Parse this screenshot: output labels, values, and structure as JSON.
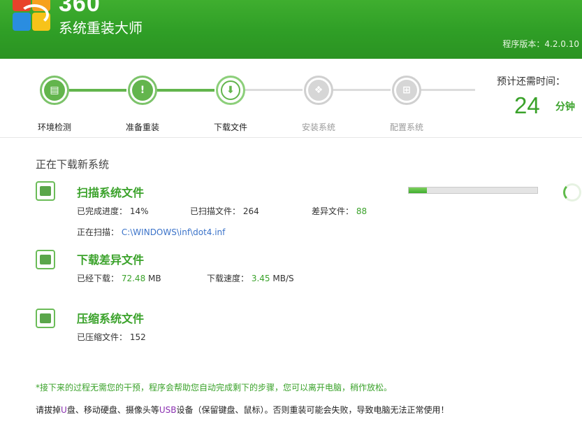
{
  "header": {
    "brand_number": "360",
    "brand_name": "系统重装大师",
    "version": "程序版本：4.2.0.10"
  },
  "steps": [
    {
      "label": "环境检测",
      "state": "done",
      "icon": "monitor-icon"
    },
    {
      "label": "准备重装",
      "state": "done",
      "icon": "document-icon"
    },
    {
      "label": "下载文件",
      "state": "active",
      "icon": "download-icon"
    },
    {
      "label": "安装系统",
      "state": "todo",
      "icon": "install-icon"
    },
    {
      "label": "配置系统",
      "state": "todo",
      "icon": "windows-icon"
    }
  ],
  "remaining": {
    "title": "预计还需时间：",
    "value": "24",
    "unit": "分钟"
  },
  "main": {
    "section_title": "正在下载新系统",
    "tasks": [
      {
        "title": "扫描系统文件",
        "icon": "disk-scan-icon",
        "progress_label": "已完成进度：",
        "progress_value": "14%",
        "progress_fraction": 0.14,
        "scanned_label": "已扫描文件：",
        "scanned_value": "264",
        "diff_label": "差异文件：",
        "diff_value": "88",
        "scanning_label": "正在扫描：",
        "scanning_path": "C:\\WINDOWS\\inf\\dot4.inf"
      },
      {
        "title": "下载差异文件",
        "icon": "download-file-icon",
        "downloaded_label": "已经下载：",
        "downloaded_value": "72.48",
        "downloaded_unit": "MB",
        "speed_label": "下载速度：",
        "speed_value": "3.45",
        "speed_unit": "MB/S"
      },
      {
        "title": "压缩系统文件",
        "icon": "compress-file-icon",
        "compressed_label": "已压缩文件：",
        "compressed_value": "152"
      }
    ]
  },
  "notes": {
    "line1": "*接下来的过程无需您的干预，程序会帮助您自动完成剩下的步骤，您可以离开电脑，稍作放松。",
    "line2_prefix": "请拔掉",
    "line2_u": "U",
    "line2_mid1": "盘、移动硬盘、摄像头等",
    "line2_usb": "USB",
    "line2_suffix": "设备（保留键盘、鼠标）。否则重装可能会失败，导致电脑无法正常使用！"
  },
  "colors": {
    "brand_green": "#2f9e26",
    "accent_green": "#3aa22a",
    "link_blue": "#3b73c9",
    "todo_gray": "#d6d6d6"
  }
}
